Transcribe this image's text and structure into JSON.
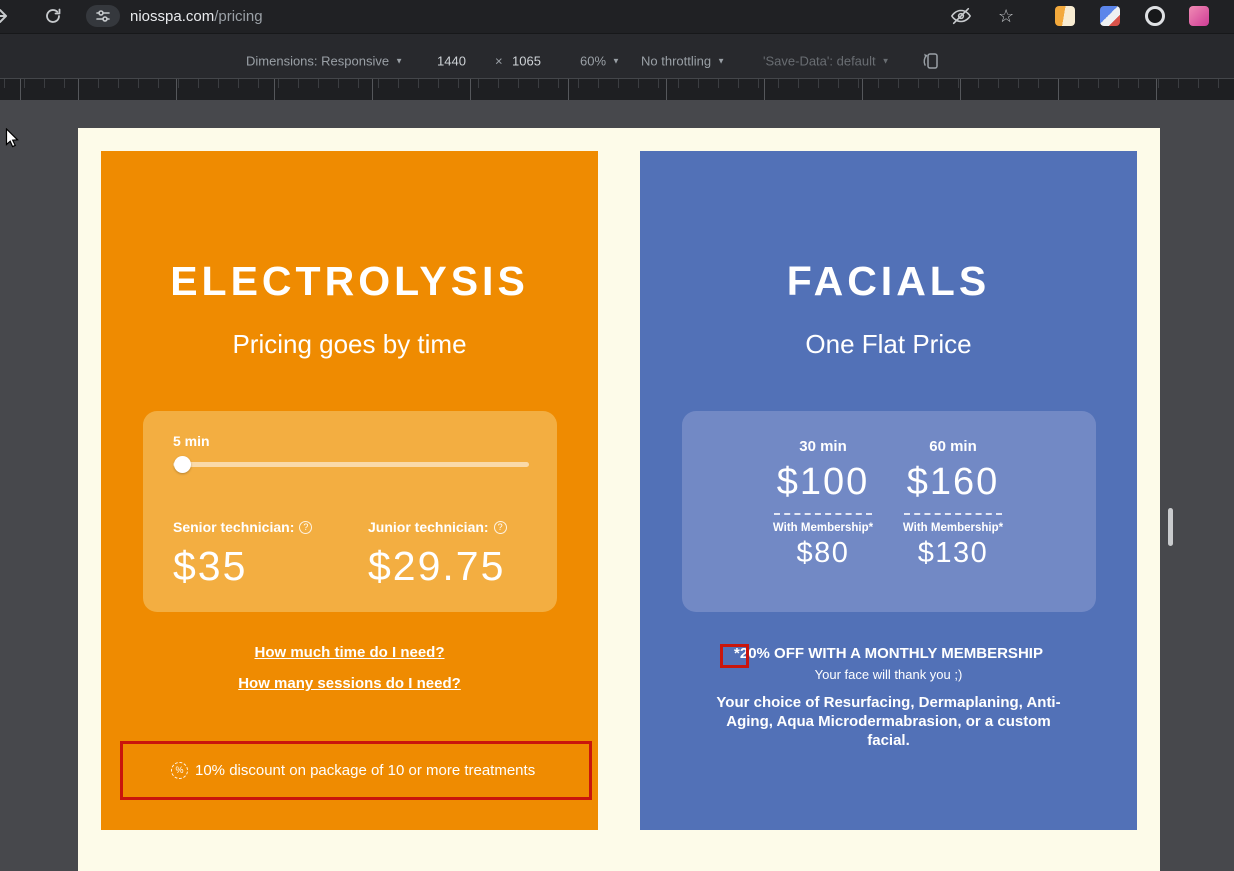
{
  "browser": {
    "url": {
      "host": "niosspa.com",
      "path": "/pricing"
    }
  },
  "devtools": {
    "dimensions_label": "Dimensions: Responsive",
    "width": "1440",
    "times": "×",
    "height": "1065",
    "zoom": "60%",
    "throttling": "No throttling",
    "save_data": "'Save-Data': default"
  },
  "icons": {
    "star": "☆",
    "arrow_down": "▼",
    "help": "?",
    "percent": "%"
  },
  "colors": {
    "electrolysis_card": "#EF8B01",
    "electrolysis_panel": "#F3AE41",
    "facials_card": "#5271B7",
    "facials_panel": "#7289C5",
    "page_background": "#FDFBE9",
    "highlight_red": "#C9150C"
  },
  "electrolysis": {
    "title": "ELECTROLYSIS",
    "subtitle": "Pricing goes by time",
    "slider_value": "5 min",
    "senior_label": "Senior technician:",
    "senior_price": "$35",
    "junior_label": "Junior technician:",
    "junior_price": "$29.75",
    "link_time": "How much time do I need?",
    "link_sessions": "How many sessions do I need?",
    "discount_note": "10% discount on package of 10 or more treatments"
  },
  "facials": {
    "title": "FACIALS",
    "subtitle": "One Flat Price",
    "columns": [
      {
        "duration": "30 min",
        "price": "$100",
        "membership_label": "With Membership*",
        "membership_price": "$80"
      },
      {
        "duration": "60 min",
        "price": "$160",
        "membership_label": "With Membership*",
        "membership_price": "$130"
      }
    ],
    "promo": "*20% OFF WITH A MONTHLY MEMBERSHIP",
    "promo_sub": "Your face will thank you ;)",
    "description": "Your choice of Resurfacing, Dermaplaning, Anti-Aging, Aqua Microdermabrasion, or a custom facial."
  }
}
